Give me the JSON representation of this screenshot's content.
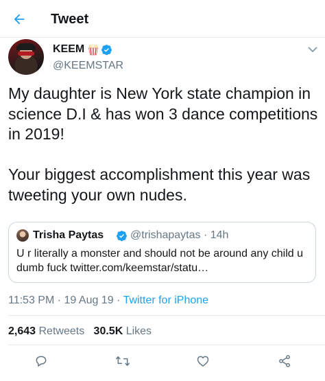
{
  "header": {
    "title": "Tweet",
    "back_icon": "back-arrow-icon",
    "accent_color": "#1da1f2"
  },
  "tweet": {
    "author": {
      "name": "KEEM",
      "handle": "@KEEMSTAR",
      "verified": true
    },
    "text": "My daughter is New York state champion in science D.I & has won 3 dance competitions in 2019!\n\nYour biggest accomplishment this year was tweeting your own nudes.",
    "quoted": {
      "name": "Trisha Paytas",
      "handle": "@trishapaytas",
      "age": "14h",
      "verified": true,
      "text": "U r literally a monster and should not be around any child u dumb fuck twitter.com/keemstar/statu…"
    },
    "time": "11:53 PM",
    "date": "19 Aug 19",
    "source": "Twitter for iPhone",
    "retweets_count": "2,643",
    "retweets_label": "Retweets",
    "likes_count": "30.5K",
    "likes_label": "Likes"
  },
  "actions": {
    "icons": [
      "reply-icon",
      "retweet-icon",
      "like-icon",
      "share-icon"
    ]
  }
}
